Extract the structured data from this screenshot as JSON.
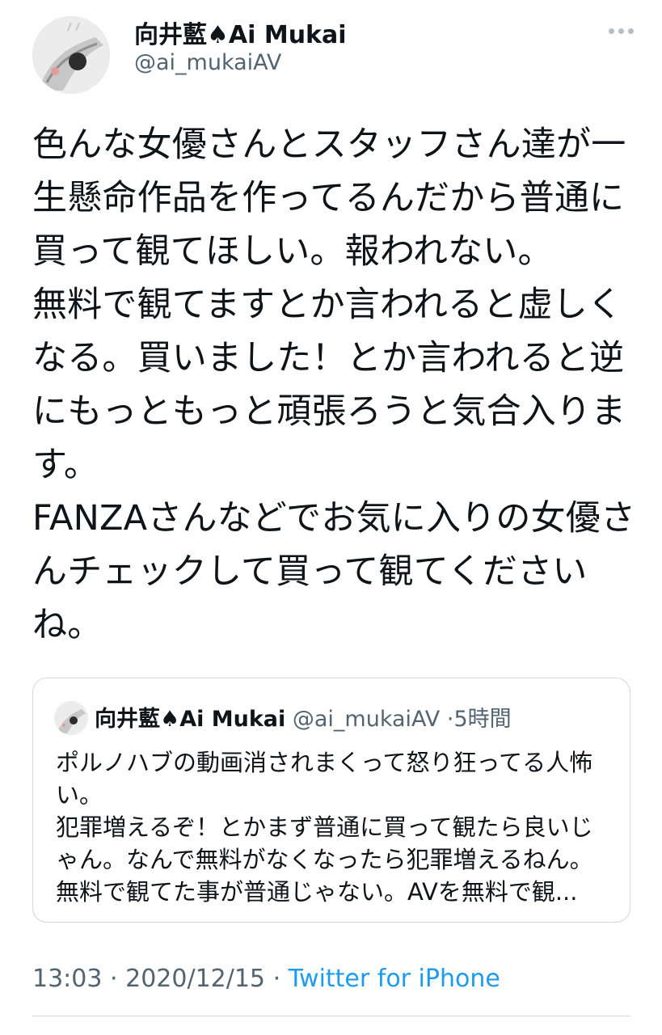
{
  "author": {
    "display_name": "向井藍♠Ai Mukai",
    "username": "@ai_mukaiAV"
  },
  "tweet": {
    "lines": [
      "色んな女優さんとスタッフさん達が一",
      "生懸命作品を作ってるんだから普通に",
      "買って観てほしい。報われない。",
      "無料で観てますとか言われると虚しく",
      "なる。買いました！とか言われると逆",
      "にもっともっと頑張ろうと気合入りま",
      "す。",
      "FANZAさんなどでお気に入りの女優さ",
      "んチェックして買って観てください",
      "ね。"
    ]
  },
  "quote": {
    "display_name": "向井藍♠Ai Mukai",
    "username": "@ai_mukaiAV",
    "separator": "·",
    "time": "5時間",
    "lines": [
      "ポルノハブの動画消されまくって怒り狂ってる人怖",
      "い。",
      "犯罪増えるぞ！とかまず普通に買って観たら良いじ",
      "ゃん。なんで無料がなくなったら犯罪増えるねん。",
      "無料で観てた事が普通じゃない。AVを無料で観..."
    ]
  },
  "meta": {
    "time": "13:03",
    "separator_1": "·",
    "date": "2020/12/15",
    "separator_2": "·",
    "source": "Twitter for iPhone"
  },
  "icons": {
    "more": "more-horizontal-icon"
  },
  "colors": {
    "text": "#0f1419",
    "secondary": "#536471",
    "link": "#1d9bf0",
    "border": "#cfd9de"
  }
}
